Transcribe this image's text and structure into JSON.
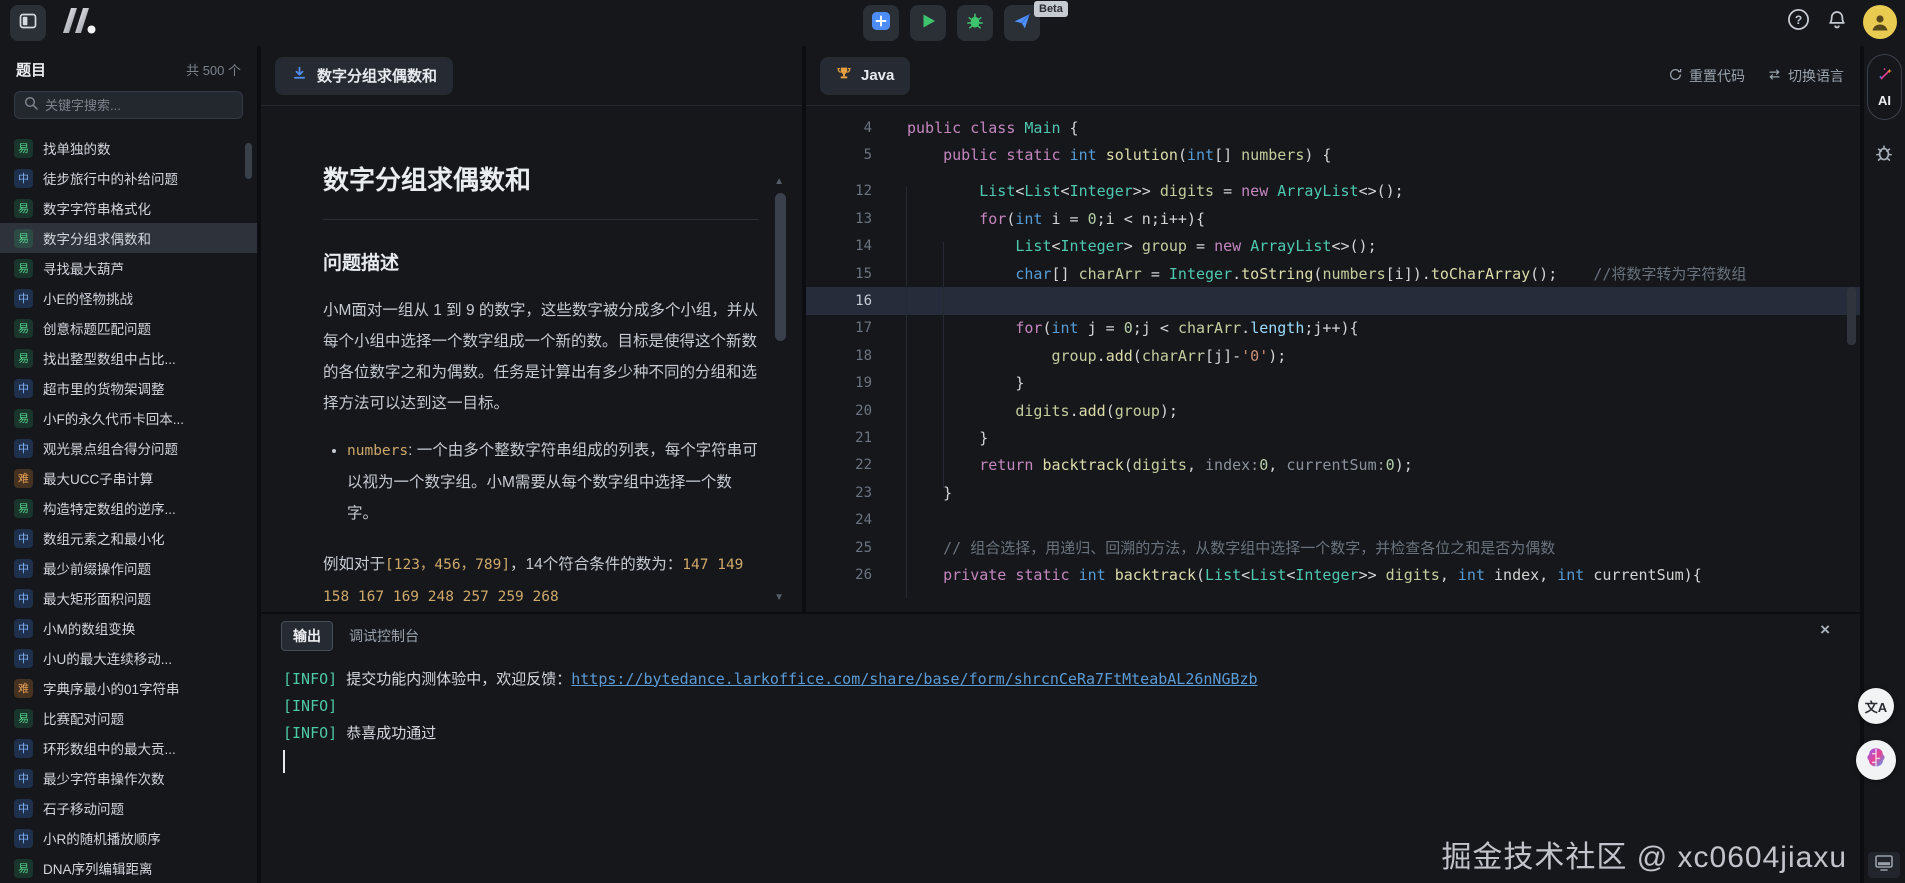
{
  "topbar": {
    "beta_badge": "Beta"
  },
  "icons": {
    "close": "×",
    "scroll_up": "▲",
    "scroll_down": "▼",
    "translate": "文A",
    "help": "?"
  },
  "sidebar": {
    "title": "题目",
    "count": "共 500 个",
    "search_placeholder": "关键字搜索...",
    "items": [
      {
        "difficulty": "易",
        "level": "easy",
        "label": "找单独的数",
        "selected": false
      },
      {
        "difficulty": "中",
        "level": "medium",
        "label": "徒步旅行中的补给问题",
        "selected": false
      },
      {
        "difficulty": "易",
        "level": "easy",
        "label": "数字字符串格式化",
        "selected": false
      },
      {
        "difficulty": "易",
        "level": "easy",
        "label": "数字分组求偶数和",
        "selected": true
      },
      {
        "difficulty": "易",
        "level": "easy",
        "label": "寻找最大葫芦",
        "selected": false
      },
      {
        "difficulty": "中",
        "level": "medium",
        "label": "小E的怪物挑战",
        "selected": false
      },
      {
        "difficulty": "易",
        "level": "easy",
        "label": "创意标题匹配问题",
        "selected": false
      },
      {
        "difficulty": "易",
        "level": "easy",
        "label": "找出整型数组中占比...",
        "selected": false
      },
      {
        "difficulty": "中",
        "level": "medium",
        "label": "超市里的货物架调整",
        "selected": false
      },
      {
        "difficulty": "易",
        "level": "easy",
        "label": "小F的永久代币卡回本...",
        "selected": false
      },
      {
        "difficulty": "中",
        "level": "medium",
        "label": "观光景点组合得分问题",
        "selected": false
      },
      {
        "difficulty": "难",
        "level": "hard",
        "label": "最大UCC子串计算",
        "selected": false
      },
      {
        "difficulty": "易",
        "level": "easy",
        "label": "构造特定数组的逆序...",
        "selected": false
      },
      {
        "difficulty": "中",
        "level": "medium",
        "label": "数组元素之和最小化",
        "selected": false
      },
      {
        "difficulty": "中",
        "level": "medium",
        "label": "最少前缀操作问题",
        "selected": false
      },
      {
        "difficulty": "中",
        "level": "medium",
        "label": "最大矩形面积问题",
        "selected": false
      },
      {
        "difficulty": "中",
        "level": "medium",
        "label": "小M的数组变换",
        "selected": false
      },
      {
        "difficulty": "中",
        "level": "medium",
        "label": "小U的最大连续移动...",
        "selected": false
      },
      {
        "difficulty": "难",
        "level": "hard",
        "label": "字典序最小的01字符串",
        "selected": false
      },
      {
        "difficulty": "易",
        "level": "easy",
        "label": "比赛配对问题",
        "selected": false
      },
      {
        "difficulty": "中",
        "level": "medium",
        "label": "环形数组中的最大贡...",
        "selected": false
      },
      {
        "difficulty": "中",
        "level": "medium",
        "label": "最少字符串操作次数",
        "selected": false
      },
      {
        "difficulty": "中",
        "level": "medium",
        "label": "石子移动问题",
        "selected": false
      },
      {
        "difficulty": "中",
        "level": "medium",
        "label": "小R的随机播放顺序",
        "selected": false
      },
      {
        "difficulty": "易",
        "level": "easy",
        "label": "DNA序列编辑距离",
        "selected": false
      }
    ]
  },
  "problem": {
    "tab": "数字分组求偶数和",
    "title": "数字分组求偶数和",
    "section_heading": "问题描述",
    "paragraph": "小M面对一组从 1 到 9 的数字，这些数字被分成多个小组，并从每个小组中选择一个数字组成一个新的数。目标是使得这个新数的各位数字之和为偶数。任务是计算出有多少种不同的分组和选择方法可以达到这一目标。",
    "bullet_code": "numbers",
    "bullet_text": ": 一个由多个整数字符串组成的列表，每个字符串可以视为一个数字组。小M需要从每个数字组中选择一个数字。",
    "example_prefix": "例如对于",
    "example_code1": "[123，456，789]",
    "example_mid": "，14个符合条件的数为：",
    "example_code2": "147 149 158 167 169 248 257 259 268"
  },
  "editor": {
    "tab": "Java",
    "reset_label": "重置代码",
    "switch_label": "切换语言",
    "lines": [
      {
        "num": 4,
        "tokens": [
          [
            "k",
            "public class "
          ],
          [
            "t",
            "Main"
          ],
          [
            "p",
            " {"
          ]
        ]
      },
      {
        "num": 5,
        "tokens": [
          [
            "p",
            "    "
          ],
          [
            "k",
            "public static "
          ],
          [
            "b",
            "int "
          ],
          [
            "f",
            "solution"
          ],
          [
            "p",
            "("
          ],
          [
            "b",
            "int"
          ],
          [
            "p",
            "[] "
          ],
          [
            "v",
            "numbers"
          ],
          [
            "p",
            ") {"
          ]
        ]
      },
      {
        "num": 12,
        "gap": true,
        "tokens": [
          [
            "p",
            "        "
          ],
          [
            "t",
            "List"
          ],
          [
            "p",
            "<"
          ],
          [
            "t",
            "List"
          ],
          [
            "p",
            "<"
          ],
          [
            "t",
            "Integer"
          ],
          [
            "p",
            ">> "
          ],
          [
            "v",
            "digits"
          ],
          [
            "p",
            " = "
          ],
          [
            "k",
            "new "
          ],
          [
            "t",
            "ArrayList"
          ],
          [
            "p",
            "<>();"
          ]
        ]
      },
      {
        "num": 13,
        "tokens": [
          [
            "p",
            "        "
          ],
          [
            "k",
            "for"
          ],
          [
            "p",
            "("
          ],
          [
            "b",
            "int "
          ],
          [
            "p",
            "i = "
          ],
          [
            "n",
            "0"
          ],
          [
            "p",
            ";i < n;i++){"
          ]
        ]
      },
      {
        "num": 14,
        "tokens": [
          [
            "p",
            "            "
          ],
          [
            "t",
            "List"
          ],
          [
            "p",
            "<"
          ],
          [
            "t",
            "Integer"
          ],
          [
            "p",
            "> "
          ],
          [
            "v",
            "group"
          ],
          [
            "p",
            " = "
          ],
          [
            "k",
            "new "
          ],
          [
            "t",
            "ArrayList"
          ],
          [
            "p",
            "<>();"
          ]
        ]
      },
      {
        "num": 15,
        "tokens": [
          [
            "p",
            "            "
          ],
          [
            "b",
            "char"
          ],
          [
            "p",
            "[] "
          ],
          [
            "v",
            "charArr"
          ],
          [
            "p",
            " = "
          ],
          [
            "t",
            "Integer"
          ],
          [
            "p",
            "."
          ],
          [
            "f",
            "toString"
          ],
          [
            "p",
            "("
          ],
          [
            "v",
            "numbers"
          ],
          [
            "p",
            "[i])."
          ],
          [
            "f",
            "toCharArray"
          ],
          [
            "p",
            "();    "
          ],
          [
            "c",
            "//将数字转为字符数组"
          ]
        ]
      },
      {
        "num": 16,
        "hl": true,
        "tokens": []
      },
      {
        "num": 17,
        "tokens": [
          [
            "p",
            "            "
          ],
          [
            "k",
            "for"
          ],
          [
            "p",
            "("
          ],
          [
            "b",
            "int "
          ],
          [
            "p",
            "j = "
          ],
          [
            "n",
            "0"
          ],
          [
            "p",
            ";j < "
          ],
          [
            "v",
            "charArr"
          ],
          [
            "p",
            "."
          ],
          [
            "m",
            "length"
          ],
          [
            "p",
            ";j++){"
          ]
        ]
      },
      {
        "num": 18,
        "tokens": [
          [
            "p",
            "                "
          ],
          [
            "v",
            "group"
          ],
          [
            "p",
            "."
          ],
          [
            "f",
            "add"
          ],
          [
            "p",
            "("
          ],
          [
            "v",
            "charArr"
          ],
          [
            "p",
            "[j]-"
          ],
          [
            "s",
            "'0'"
          ],
          [
            "p",
            ");"
          ]
        ]
      },
      {
        "num": 19,
        "tokens": [
          [
            "p",
            "            }"
          ]
        ]
      },
      {
        "num": 20,
        "tokens": [
          [
            "p",
            "            "
          ],
          [
            "v",
            "digits"
          ],
          [
            "p",
            "."
          ],
          [
            "f",
            "add"
          ],
          [
            "p",
            "("
          ],
          [
            "v",
            "group"
          ],
          [
            "p",
            ");"
          ]
        ]
      },
      {
        "num": 21,
        "tokens": [
          [
            "p",
            "        }"
          ]
        ]
      },
      {
        "num": 22,
        "tokens": [
          [
            "p",
            "        "
          ],
          [
            "k",
            "return "
          ],
          [
            "f",
            "backtrack"
          ],
          [
            "p",
            "("
          ],
          [
            "v",
            "digits"
          ],
          [
            "p",
            ", "
          ],
          [
            "h",
            "index:"
          ],
          [
            "n",
            "0"
          ],
          [
            "p",
            ", "
          ],
          [
            "h",
            "currentSum:"
          ],
          [
            "n",
            "0"
          ],
          [
            "p",
            ");"
          ]
        ]
      },
      {
        "num": 23,
        "tokens": [
          [
            "p",
            "    }"
          ]
        ]
      },
      {
        "num": 24,
        "tokens": []
      },
      {
        "num": 25,
        "tokens": [
          [
            "p",
            "    "
          ],
          [
            "c",
            "// 组合选择，用递归、回溯的方法，从数字组中选择一个数字，并检查各位之和是否为偶数"
          ]
        ]
      },
      {
        "num": 26,
        "tokens": [
          [
            "p",
            "    "
          ],
          [
            "k",
            "private static "
          ],
          [
            "b",
            "int "
          ],
          [
            "f",
            "backtrack"
          ],
          [
            "p",
            "("
          ],
          [
            "t",
            "List"
          ],
          [
            "p",
            "<"
          ],
          [
            "t",
            "List"
          ],
          [
            "p",
            "<"
          ],
          [
            "t",
            "Integer"
          ],
          [
            "p",
            ">> "
          ],
          [
            "v",
            "digits"
          ],
          [
            "p",
            ", "
          ],
          [
            "b",
            "int "
          ],
          [
            "p",
            "index, "
          ],
          [
            "b",
            "int "
          ],
          [
            "p",
            "currentSum){"
          ]
        ]
      }
    ]
  },
  "console": {
    "tab_output": "输出",
    "tab_debug": "调试控制台",
    "lines": [
      {
        "tag": "[INFO]",
        "segments": [
          {
            "t": " 提交功能内测体验中，欢迎反馈："
          },
          {
            "t": "https://bytedance.larkoffice.com/share/base/form/shrcnCeRa7FtMteabAL26nNGBzb",
            "link": true
          }
        ]
      },
      {
        "tag": "[INFO]",
        "segments": []
      },
      {
        "tag": "[INFO]",
        "segments": [
          {
            "t": " 恭喜成功通过"
          }
        ]
      }
    ]
  },
  "right_rail": {
    "ai_label": "AI"
  },
  "watermark": "掘金技术社区 @ xc0604jiaxu",
  "colors": {
    "accent_blue": "#4d8df7",
    "run_green": "#3ec46d",
    "easy_green": "#54d38c",
    "medium_blue": "#7fb0f6",
    "hard_orange": "#e8a158",
    "link_blue": "#5b9bd5",
    "info_teal": "#4ec9a6",
    "trophy_orange": "#e3a23f"
  }
}
